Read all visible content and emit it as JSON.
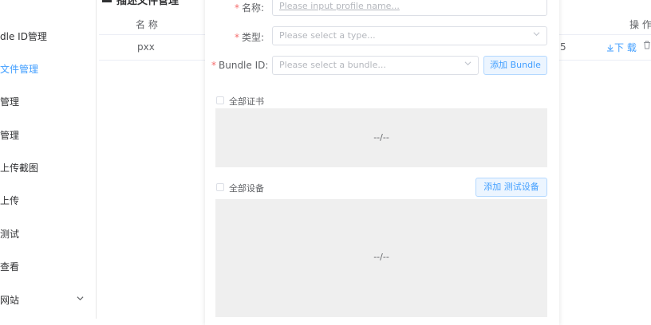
{
  "sidebar": {
    "items": [
      {
        "label": "dle ID管理",
        "active": false
      },
      {
        "label": "文件管理",
        "active": true
      },
      {
        "label": "管理",
        "active": false
      },
      {
        "label": "管理",
        "active": false
      },
      {
        "label": "上传截图",
        "active": false
      },
      {
        "label": "上传",
        "active": false
      },
      {
        "label": "测试",
        "active": false
      },
      {
        "label": "查看",
        "active": false
      },
      {
        "label": "网站",
        "active": false
      }
    ]
  },
  "background": {
    "title": "描述文件管理",
    "table": {
      "headers": {
        "name": "名 称",
        "ops": "操 作"
      },
      "row": {
        "name": "pxx",
        "partial": "5",
        "download": "下 载"
      }
    }
  },
  "dialog": {
    "name": {
      "label": "名称:",
      "placeholder": "Please input profile name..."
    },
    "type": {
      "label": "类型:",
      "placeholder": "Please select a type..."
    },
    "bundle": {
      "label": "Bundle ID:",
      "placeholder": "Please select a bundle...",
      "add_button": "添加 Bundle"
    },
    "certs": {
      "checkbox_label": "全部证书",
      "empty": "--/--"
    },
    "devices": {
      "checkbox_label": "全部设备",
      "add_button": "添加 测试设备",
      "empty": "--/--"
    }
  },
  "icons": {
    "chevron": "chevron-down-icon",
    "download": "download-icon",
    "delete": "trash-icon"
  },
  "colors": {
    "accent": "#409eff",
    "required": "#f56c6c",
    "panel": "#efefef"
  }
}
